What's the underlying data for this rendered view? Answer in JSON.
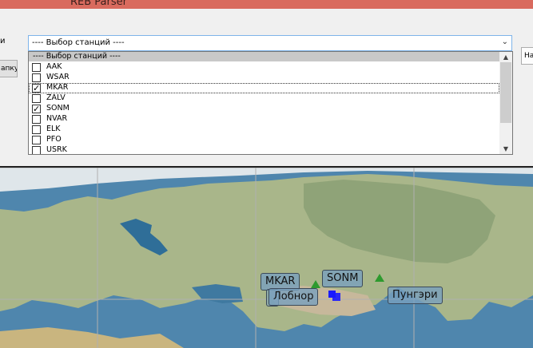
{
  "window": {
    "title": "REB Parser"
  },
  "form": {
    "left_label": "и",
    "left_button_label": "апку",
    "right_button_label": "На"
  },
  "station_combo": {
    "selected": "---- Выбор станций ----",
    "arrow_icon": "chevron-down-icon"
  },
  "station_list": {
    "header": "---- Выбор станций ----",
    "items": [
      {
        "label": "AAK",
        "checked": false
      },
      {
        "label": "WSAR",
        "checked": false
      },
      {
        "label": "MKAR",
        "checked": true
      },
      {
        "label": "ZALV",
        "checked": false
      },
      {
        "label": "SONM",
        "checked": true
      },
      {
        "label": "NVAR",
        "checked": false
      },
      {
        "label": "ELK",
        "checked": false
      },
      {
        "label": "PFO",
        "checked": false
      },
      {
        "label": "USRK",
        "checked": false
      }
    ]
  },
  "map": {
    "stations": [
      "MKAR",
      "SONM"
    ],
    "events": [
      "Лобнор",
      "Пунгэри"
    ],
    "colors": {
      "station_marker": "#2e9a2e",
      "event_marker": "#1a1aff",
      "label_bg": "#789fbe"
    }
  }
}
